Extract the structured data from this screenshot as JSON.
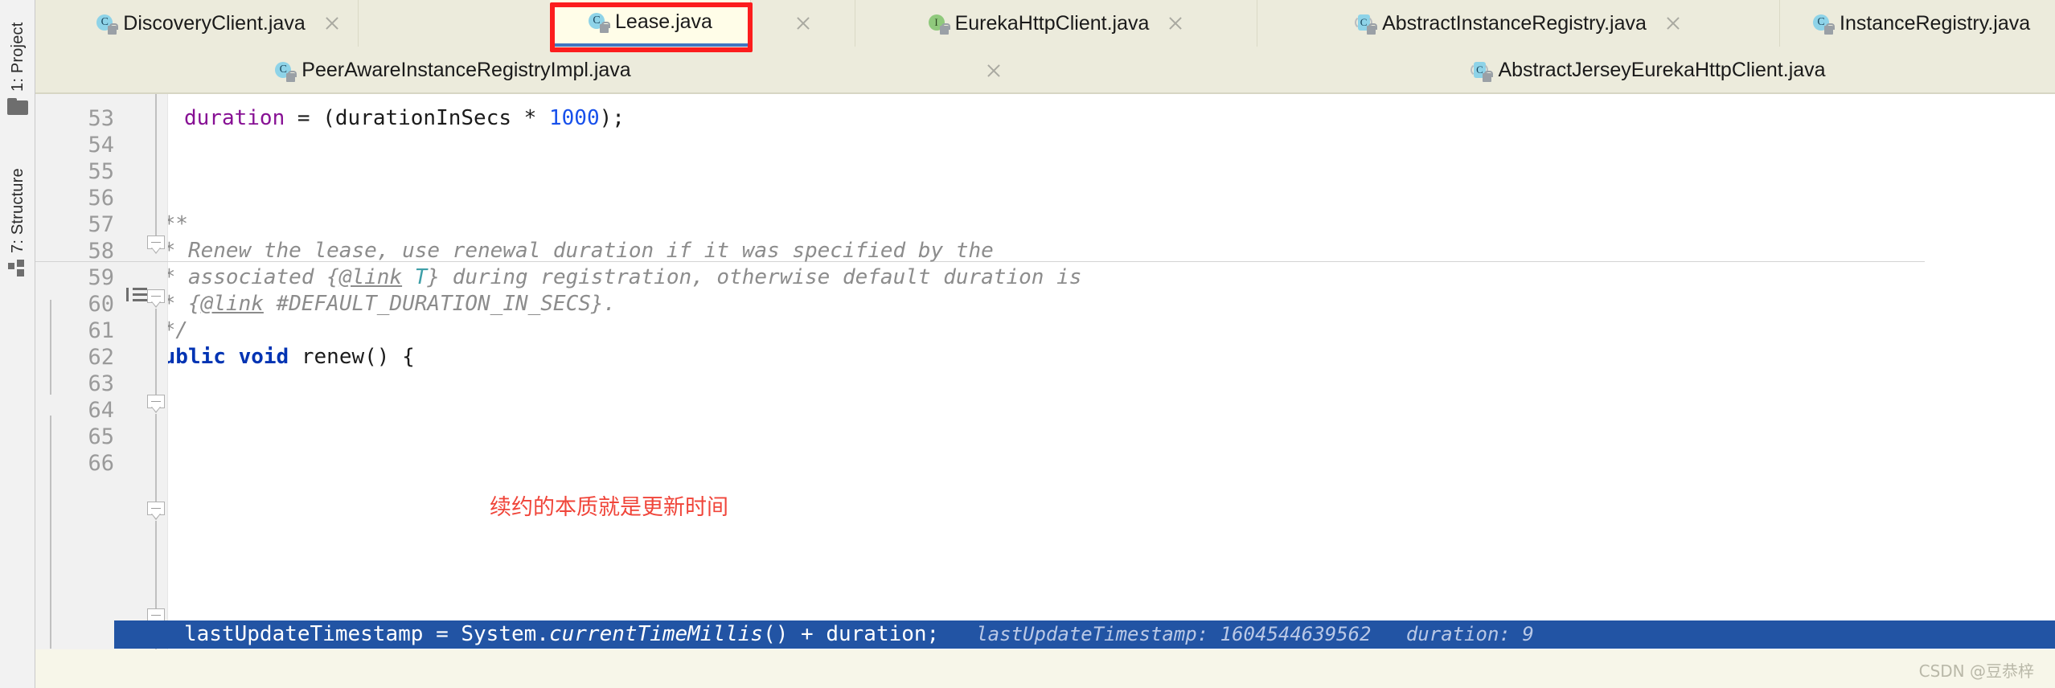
{
  "window": {
    "background_color": "#ffffff",
    "accent_color": "#4176c1",
    "annotation_color": "#fc1d1d"
  },
  "sidebar": {
    "items": [
      {
        "label": "1: Project",
        "icon": "folder-icon"
      },
      {
        "label": "7: Structure",
        "icon": "structure-icon"
      }
    ]
  },
  "editor_tabs": {
    "row1": [
      {
        "label": "DiscoveryClient.java",
        "icon": "java-class-icon",
        "icon_kind": "class",
        "active": false,
        "closable": true
      },
      {
        "label": "Lease.java",
        "icon": "java-class-icon",
        "icon_kind": "class",
        "active": true,
        "closable": true
      },
      {
        "label": "EurekaHttpClient.java",
        "icon": "java-interface-icon",
        "icon_kind": "interface",
        "active": false,
        "closable": true
      },
      {
        "label": "AbstractInstanceRegistry.java",
        "icon": "java-abstract-class-icon",
        "icon_kind": "abstract",
        "active": false,
        "closable": true
      },
      {
        "label": "InstanceRegistry.java",
        "icon": "java-class-icon",
        "icon_kind": "class",
        "active": false,
        "closable": false
      }
    ],
    "row2": [
      {
        "label": "PeerAwareInstanceRegistryImpl.java",
        "icon": "java-class-icon",
        "icon_kind": "class",
        "active": false,
        "closable": true
      },
      {
        "label": "AbstractJerseyEurekaHttpClient.java",
        "icon": "java-abstract-class-icon",
        "icon_kind": "abstract",
        "active": false,
        "closable": false
      }
    ]
  },
  "code": {
    "lines": [
      {
        "num": "53",
        "indent": 2,
        "tokens": [
          {
            "t": "duration",
            "c": "field"
          },
          {
            "t": " = (",
            "c": "plain"
          },
          {
            "t": "durationInSecs",
            "c": "plain"
          },
          {
            "t": " * ",
            "c": "plain"
          },
          {
            "t": "1000",
            "c": "num"
          },
          {
            "t": ");",
            "c": "plain"
          }
        ]
      },
      {
        "num": "54",
        "indent": 0,
        "tokens": []
      },
      {
        "num": "55",
        "indent": 1,
        "tokens": [
          {
            "t": "}",
            "c": "plain"
          }
        ]
      },
      {
        "num": "56",
        "indent": 0,
        "tokens": []
      },
      {
        "num": "57",
        "indent": 1,
        "tokens": [
          {
            "t": "/**",
            "c": "cmt"
          }
        ]
      },
      {
        "num": "58",
        "indent": 1,
        "tokens": [
          {
            "t": " * Renew the lease, use renewal duration if it was specified by the",
            "c": "cmt"
          }
        ]
      },
      {
        "num": "59",
        "indent": 1,
        "tokens": [
          {
            "t": " * associated {",
            "c": "cmt"
          },
          {
            "t": "@link",
            "c": "cmtlink"
          },
          {
            "t": " ",
            "c": "cmt"
          },
          {
            "t": "T",
            "c": "cmtparam"
          },
          {
            "t": "} during registration, otherwise default duration is",
            "c": "cmt"
          }
        ]
      },
      {
        "num": "60",
        "indent": 1,
        "tokens": [
          {
            "t": " * {",
            "c": "cmt"
          },
          {
            "t": "@link",
            "c": "cmtlink"
          },
          {
            "t": " #DEFAULT_DURATION_IN_SECS}.",
            "c": "cmt"
          }
        ]
      },
      {
        "num": "61",
        "indent": 1,
        "tokens": [
          {
            "t": " */",
            "c": "cmt"
          }
        ]
      },
      {
        "num": "62",
        "indent": 1,
        "tokens": [
          {
            "t": "public",
            "c": "kw"
          },
          {
            "t": " ",
            "c": "plain"
          },
          {
            "t": "void",
            "c": "kw"
          },
          {
            "t": " renew() {",
            "c": "plain"
          }
        ]
      },
      {
        "num": "63",
        "indent": 2,
        "highlighted": true,
        "tokens": []
      },
      {
        "num": "64",
        "indent": 0,
        "tokens": []
      },
      {
        "num": "65",
        "indent": 1,
        "tokens": [
          {
            "t": "}",
            "c": "plain"
          }
        ]
      },
      {
        "num": "66",
        "indent": 0,
        "tokens": []
      }
    ],
    "exec_line": {
      "line_number": "63",
      "code_prefix": "lastUpdateTimestamp = System.",
      "code_method": "currentTimeMillis",
      "code_suffix": "() + duration;",
      "debug_values": "lastUpdateTimestamp: 1604544639562   duration: 9"
    },
    "annotation_zh": "续约的本质就是更新时间",
    "breakpoint_line": "63"
  },
  "watermark": {
    "text": "CSDN @豆恭梓"
  }
}
